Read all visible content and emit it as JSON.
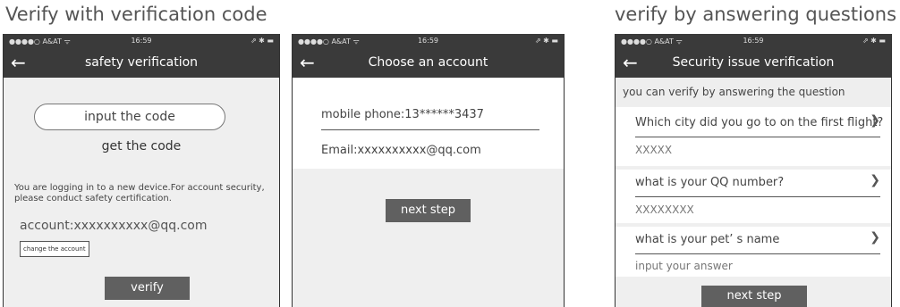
{
  "headings": {
    "left": "Verify with verification code",
    "right": "verify by answering questions"
  },
  "status_bar": {
    "carrier": "●●●●○ A&AT ᯤ",
    "time": "16:59",
    "battery": "⇗ ✱ ▬"
  },
  "phone1": {
    "title": "safety verification",
    "code_input_label": "input the code",
    "get_code": "get the code",
    "notice": "You are logging in to a new device.For account security, please conduct safety certification.",
    "account": "account:xxxxxxxxxx@qq.com",
    "change_account": "change the account",
    "verify": "verify"
  },
  "phone2": {
    "title": "Choose an account",
    "mobile": "mobile phone:13******3437",
    "email": "Email:xxxxxxxxxx@qq.com",
    "next": "next step"
  },
  "phone3": {
    "title": "Security issue verification",
    "hint": "you can verify by answering the question",
    "questions": [
      {
        "q": "Which city did you go to on the first flight?",
        "a": "XXXXX"
      },
      {
        "q": "what is your QQ number?",
        "a": "XXXXXXXX"
      },
      {
        "q": "what is your pet’ s name",
        "a": "input your answer"
      }
    ],
    "next": "next step"
  },
  "icons": {
    "back": "back-arrow-icon",
    "chevron": "chevron-right-icon"
  }
}
